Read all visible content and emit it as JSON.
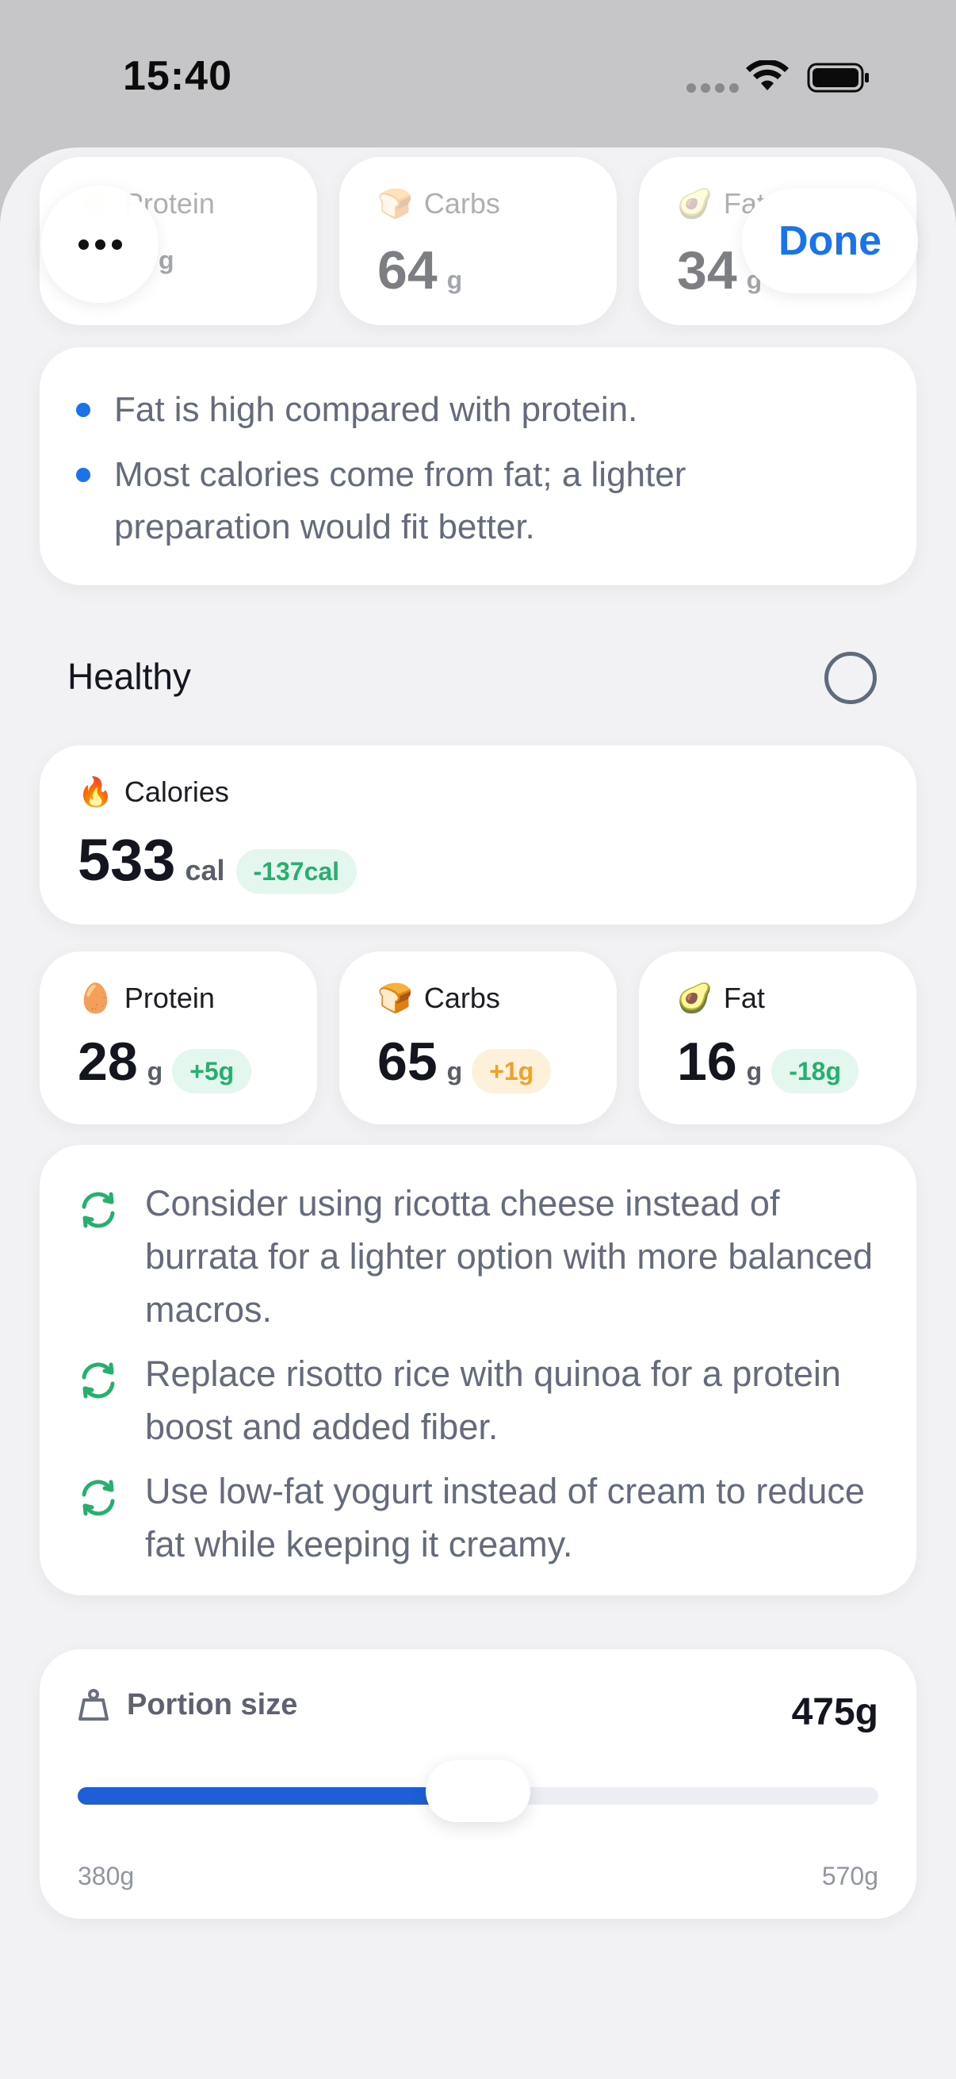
{
  "status_bar": {
    "time": "15:40"
  },
  "header": {
    "done_label": "Done"
  },
  "top_macros": [
    {
      "emoji": "🥚",
      "label": "Protein",
      "value": "",
      "unit": "g"
    },
    {
      "emoji": "🍞",
      "label": "Carbs",
      "value": "64",
      "unit": "g"
    },
    {
      "emoji": "🥑",
      "label": "Fat",
      "value": "34",
      "unit": "g"
    }
  ],
  "notes": [
    "Fat is high compared with protein.",
    "Most calories come from fat; a lighter preparation would fit better."
  ],
  "healthy": {
    "title": "Healthy",
    "selected": false
  },
  "calories": {
    "emoji": "🔥",
    "label": "Calories",
    "value": "533",
    "unit": "cal",
    "delta": "-137cal"
  },
  "macros": [
    {
      "emoji": "🥚",
      "label": "Protein",
      "value": "28",
      "unit": "g",
      "delta": "+5g",
      "delta_color": "green"
    },
    {
      "emoji": "🍞",
      "label": "Carbs",
      "value": "65",
      "unit": "g",
      "delta": "+1g",
      "delta_color": "orange"
    },
    {
      "emoji": "🥑",
      "label": "Fat",
      "value": "16",
      "unit": "g",
      "delta": "-18g",
      "delta_color": "green"
    }
  ],
  "suggestions": [
    "Consider using ricotta cheese instead of burrata for a lighter option with more balanced macros.",
    "Replace risotto rice with quinoa for a protein boost and added fiber.",
    "Use low-fat yogurt instead of cream to reduce fat while keeping it creamy."
  ],
  "portion": {
    "label": "Portion size",
    "value": "475g",
    "min_label": "380g",
    "max_label": "570g",
    "fraction": 0.5
  },
  "colors": {
    "accent": "#1a73e8",
    "green": "#26b06e",
    "orange": "#f0a226"
  }
}
